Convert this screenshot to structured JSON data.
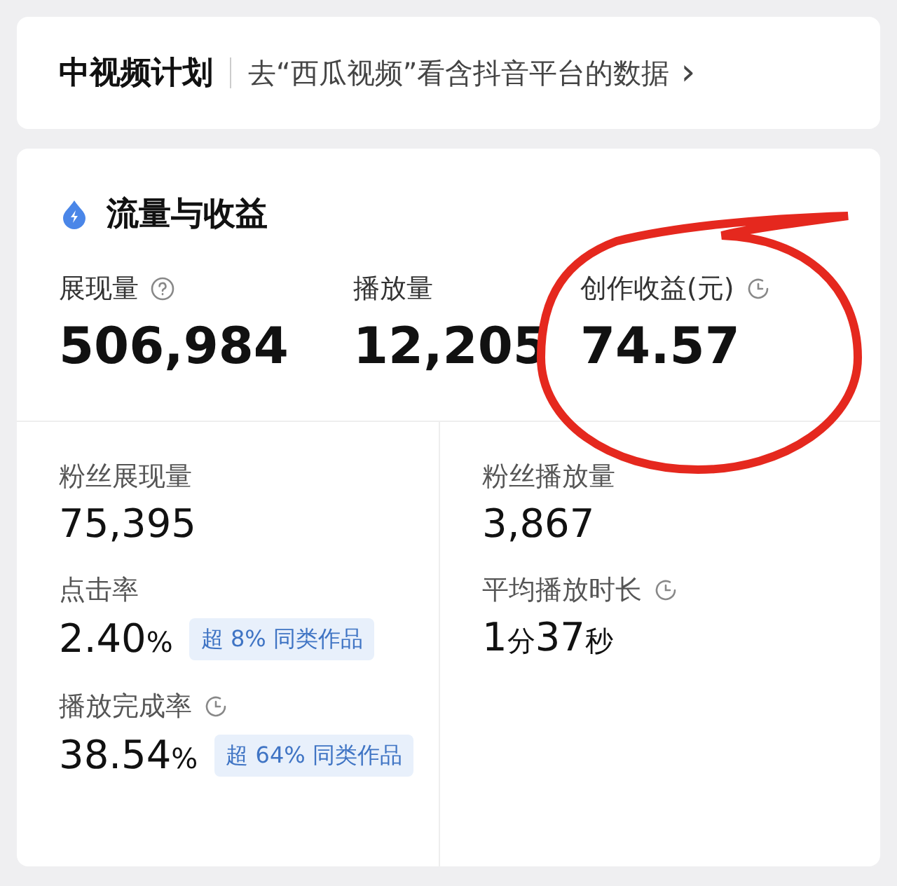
{
  "header": {
    "title": "中视频计划",
    "link": "去“西瓜视频”看含抖音平台的数据",
    "chevron": "›"
  },
  "section": {
    "title": "流量与收益"
  },
  "top_metrics": [
    {
      "label": "展现量",
      "kind": "help",
      "value": "506,984"
    },
    {
      "label": "播放量",
      "kind": "plain",
      "value": "12,205"
    },
    {
      "label": "创作收益(元)",
      "kind": "timed",
      "value": "74.57"
    }
  ],
  "left_metrics": [
    {
      "label": "粉丝展现量",
      "kind": "plain",
      "value": [
        {
          "kind": "num",
          "text": "75,395"
        }
      ]
    },
    {
      "label": "点击率",
      "kind": "plain",
      "value": [
        {
          "kind": "num",
          "text": "2.40"
        },
        {
          "kind": "unit",
          "text": "%"
        }
      ],
      "badge": "超 8% 同类作品"
    },
    {
      "label": "播放完成率",
      "kind": "timed",
      "value": [
        {
          "kind": "num",
          "text": "38.54"
        },
        {
          "kind": "unit",
          "text": "%"
        }
      ],
      "badge": "超 64% 同类作品"
    }
  ],
  "right_metrics": [
    {
      "label": "粉丝播放量",
      "kind": "plain",
      "value": [
        {
          "kind": "num",
          "text": "3,867"
        }
      ]
    },
    {
      "label": "平均播放时长",
      "kind": "timed",
      "value": [
        {
          "kind": "num",
          "text": "1"
        },
        {
          "kind": "unit",
          "text": "分"
        },
        {
          "kind": "num",
          "text": "37"
        },
        {
          "kind": "unit",
          "text": "秒"
        }
      ]
    }
  ]
}
